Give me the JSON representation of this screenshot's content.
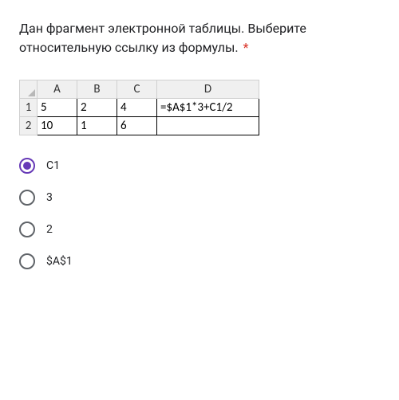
{
  "question": {
    "text": "Дан фрагмент электронной таблицы. Выберите относительную ссылку из формулы.",
    "required_mark": "*"
  },
  "spreadsheet": {
    "columns": [
      "A",
      "B",
      "C",
      "D"
    ],
    "rows": [
      {
        "num": "1",
        "cells": [
          "5",
          "2",
          "4",
          "=$A$1*3+C1/2"
        ]
      },
      {
        "num": "2",
        "cells": [
          "10",
          "1",
          "6",
          ""
        ]
      }
    ]
  },
  "options": [
    {
      "label": "C1",
      "selected": true
    },
    {
      "label": "3",
      "selected": false
    },
    {
      "label": "2",
      "selected": false
    },
    {
      "label": "$A$1",
      "selected": false
    }
  ]
}
